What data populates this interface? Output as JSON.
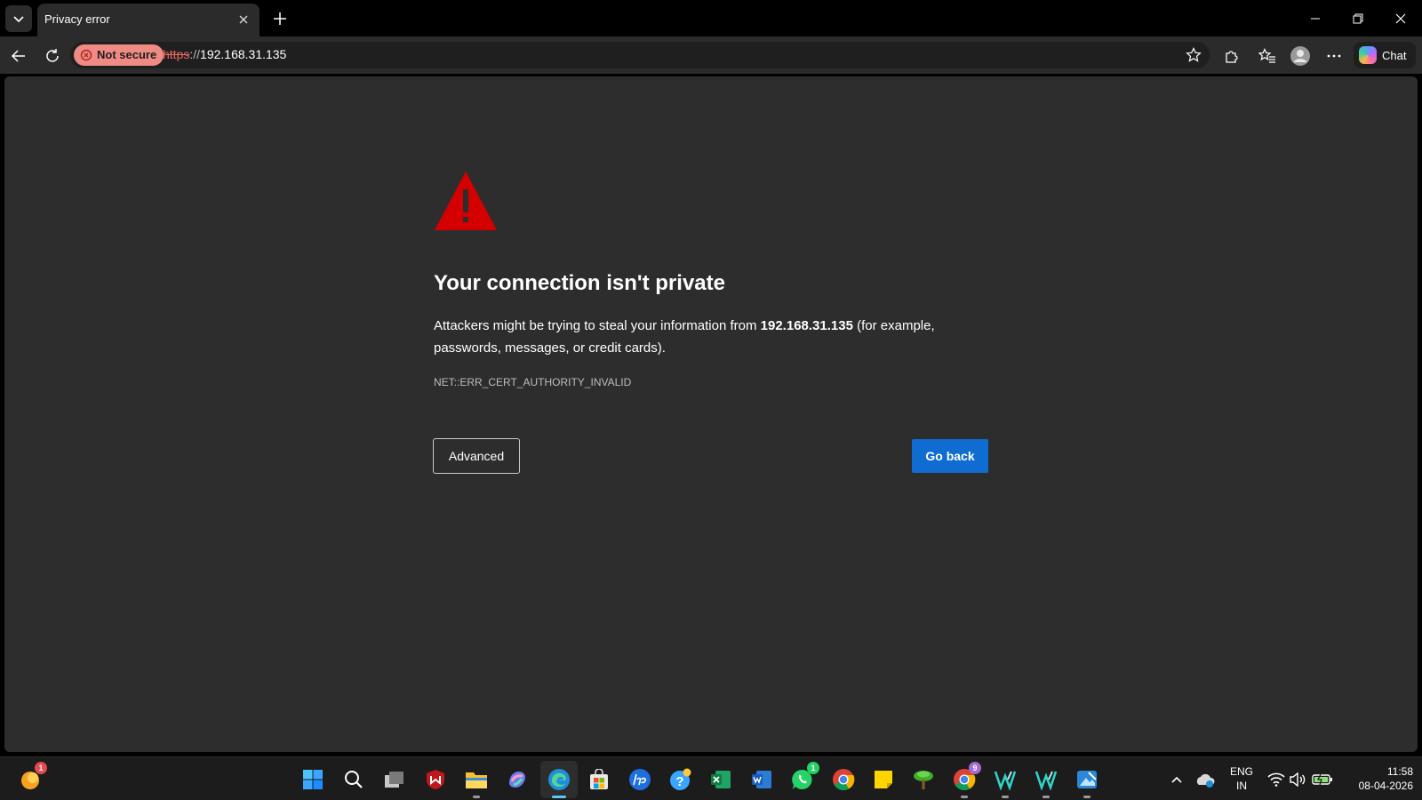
{
  "browser": {
    "tab_title": "Privacy error",
    "security_label": "Not secure",
    "url_scheme": "https",
    "url_separator": "://",
    "url_host": "192.168.31.135",
    "chat_label": "Chat"
  },
  "error_page": {
    "headline": "Your connection isn't private",
    "desc_before": "Attackers might be trying to steal your information from ",
    "desc_host": "192.168.31.135",
    "desc_after": " (for example, passwords, messages, or credit cards).",
    "error_code": "NET::ERR_CERT_AUTHORITY_INVALID",
    "advanced_label": "Advanced",
    "go_back_label": "Go back"
  },
  "taskbar": {
    "widget_badge": "1",
    "whatsapp_badge": "1",
    "chrome_badge": "9",
    "lang_top": "ENG",
    "lang_bottom": "IN",
    "time": "11:58",
    "date": "08-04-2026"
  },
  "icons": [
    "tab-list-icon",
    "close-icon",
    "plus-icon",
    "minimize-icon",
    "restore-icon",
    "back-icon",
    "refresh-icon",
    "warning-shield-icon",
    "star-icon",
    "extensions-icon",
    "favorites-icon",
    "profile-icon",
    "more-icon",
    "copilot-icon",
    "warning-triangle-icon",
    "windows-start-icon",
    "search-icon",
    "task-view-icon",
    "mcafee-icon",
    "file-explorer-icon",
    "copilot-app-icon",
    "edge-icon",
    "store-icon",
    "hp-icon",
    "help-icon",
    "excel-icon",
    "word-icon",
    "whatsapp-icon",
    "chrome-icon",
    "sticky-notes-icon",
    "tree-icon",
    "chrome-profile-icon",
    "vpn-icon",
    "vpn-alt-icon",
    "photos-icon",
    "chevron-up-icon",
    "onedrive-icon",
    "wifi-icon",
    "volume-icon",
    "battery-icon"
  ],
  "colors": {
    "accent_blue": "#0f6cd1",
    "warning_red": "#d40000",
    "insecure_pink": "#f08a85",
    "page_bg": "#2d2d2d"
  }
}
